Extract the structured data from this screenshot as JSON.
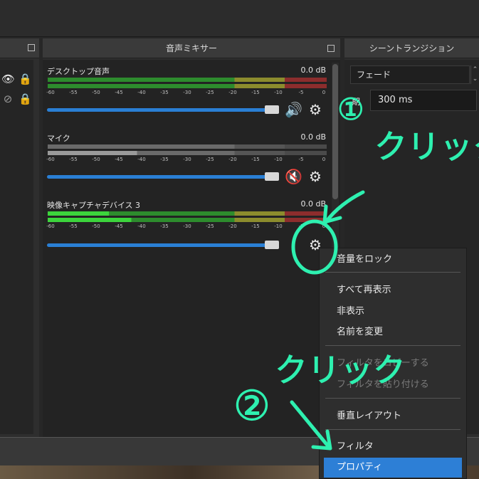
{
  "mixer": {
    "title": "音声ミキサー",
    "channels": [
      {
        "name": "デスクトップ音声",
        "db": "0.0 dB",
        "muted": false
      },
      {
        "name": "マイク",
        "db": "0.0 dB",
        "muted": true
      },
      {
        "name": "映像キャプチャデバイス 3",
        "db": "0.0 dB",
        "muted": false
      }
    ],
    "scale_ticks": [
      "-60",
      "-55",
      "-50",
      "-45",
      "-40",
      "-35",
      "-30",
      "-25",
      "-20",
      "-15",
      "-10",
      "-5",
      "0"
    ],
    "volume": 1.0
  },
  "transitions": {
    "title": "シーントランジション",
    "selected": "フェード",
    "duration_label": "期",
    "duration": "300 ms"
  },
  "context_menu": {
    "items": [
      {
        "label": "音量をロック",
        "enabled": true
      },
      {
        "label": "すべて再表示",
        "enabled": true
      },
      {
        "label": "非表示",
        "enabled": true
      },
      {
        "label": "名前を変更",
        "enabled": true
      },
      {
        "label": "フィルタをコピーする",
        "enabled": false
      },
      {
        "label": "フィルタを貼り付ける",
        "enabled": false
      },
      {
        "label": "垂直レイアウト",
        "enabled": true
      },
      {
        "label": "フィルタ",
        "enabled": true
      },
      {
        "label": "プロパティ",
        "enabled": true,
        "highlighted": true
      }
    ]
  },
  "annotations": {
    "step1_number": "①",
    "step1_text": "クリック",
    "step2_number": "②",
    "step2_text": "クリック",
    "color": "#2ef0b0"
  },
  "colors": {
    "meter_green": "#2d8c2d",
    "meter_yellow": "#8c8c2d",
    "meter_red": "#8c2d2d",
    "slider_blue": "#2a7fd4",
    "highlight_blue": "#2d7fd6",
    "mute_red": "#d42020"
  },
  "icons": [
    "eye-icon",
    "lock-icon",
    "eye-hidden-icon",
    "speaker-icon",
    "speaker-muted-icon",
    "gear-icon",
    "float-icon"
  ]
}
